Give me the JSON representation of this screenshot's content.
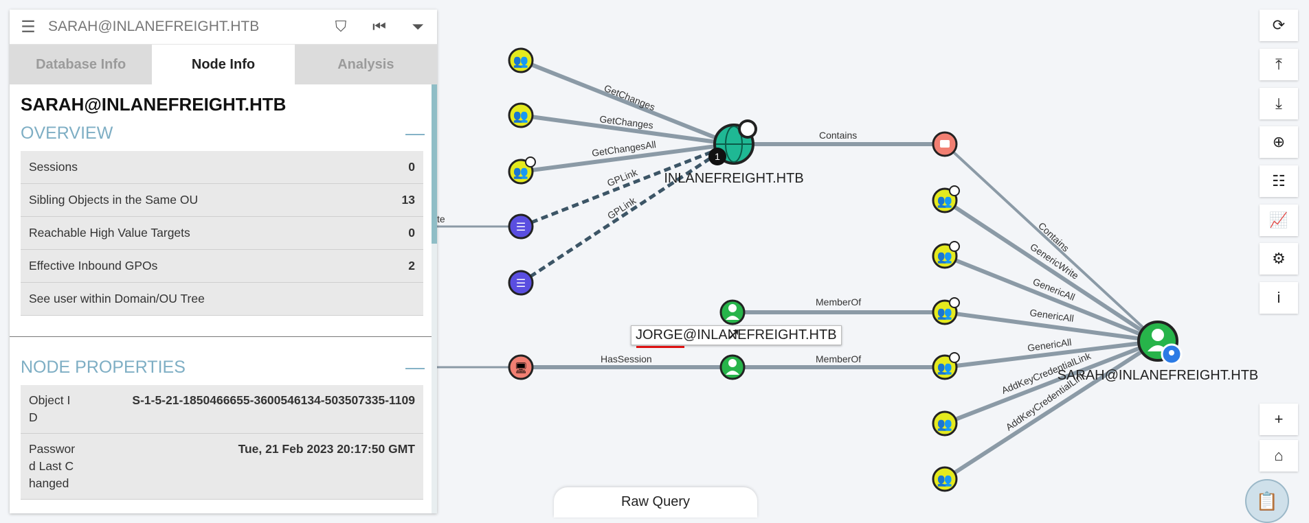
{
  "search": {
    "value": "SARAH@INLANEFREIGHT.HTB"
  },
  "tabs": [
    "Database Info",
    "Node Info",
    "Analysis"
  ],
  "node_info": {
    "name": "SARAH@INLANEFREIGHT.HTB",
    "overview_title": "OVERVIEW",
    "overview_rows": [
      {
        "label": "Sessions",
        "value": "0"
      },
      {
        "label": "Sibling Objects in the Same OU",
        "value": "13"
      },
      {
        "label": "Reachable High Value Targets",
        "value": "0"
      },
      {
        "label": "Effective Inbound GPOs",
        "value": "2"
      },
      {
        "label": "See user within Domain/OU Tree",
        "value": ""
      }
    ],
    "properties_title": "NODE PROPERTIES",
    "properties": [
      {
        "key": "Object ID",
        "value": "S-1-5-21-1850466655-3600546134-503507335-1109"
      },
      {
        "key": "Password Last Changed",
        "value": "Tue, 21 Feb 2023 20:17:50 GMT"
      }
    ]
  },
  "graph": {
    "edge_labels": {
      "getchanges1": "GetChanges",
      "getchanges2": "GetChanges",
      "getchangesall": "GetChangesAll",
      "gplink1": "GPLink",
      "gplink2": "GPLink",
      "contains1": "Contains",
      "contains2": "Contains",
      "genericwrite": "GenericWrite",
      "genericall1": "GenericAll",
      "genericall2": "GenericAll",
      "genericall3": "GenericAll",
      "addkey1": "AddKeyCredentialLink",
      "addkey2": "AddKeyCredentialLink",
      "memberof1": "MemberOf",
      "memberof2": "MemberOf",
      "hassession": "HasSession",
      "partial_left": "te"
    },
    "domain_label": "INLANEFREIGHT.HTB",
    "domain_badge": "1",
    "target_label": "SARAH@INLANEFREIGHT.HTB",
    "tooltip": "JORGE@INLANEFREIGHT.HTB"
  },
  "raw_query_label": "Raw Query",
  "icons": {
    "toolbar": [
      "refresh-icon",
      "upload-icon",
      "download-icon",
      "import-icon",
      "query-list-icon",
      "chart-icon",
      "settings-icon",
      "info-icon"
    ],
    "zoom": [
      "zoom-in-icon",
      "home-icon"
    ]
  },
  "colors": {
    "group": "#e4ea1e",
    "user_green": "#27b44a",
    "gpo": "#5a4ee0",
    "computer": "#f17f72",
    "ou": "#f17f72",
    "domain": "#1fb894",
    "accent": "#7eaec4"
  }
}
